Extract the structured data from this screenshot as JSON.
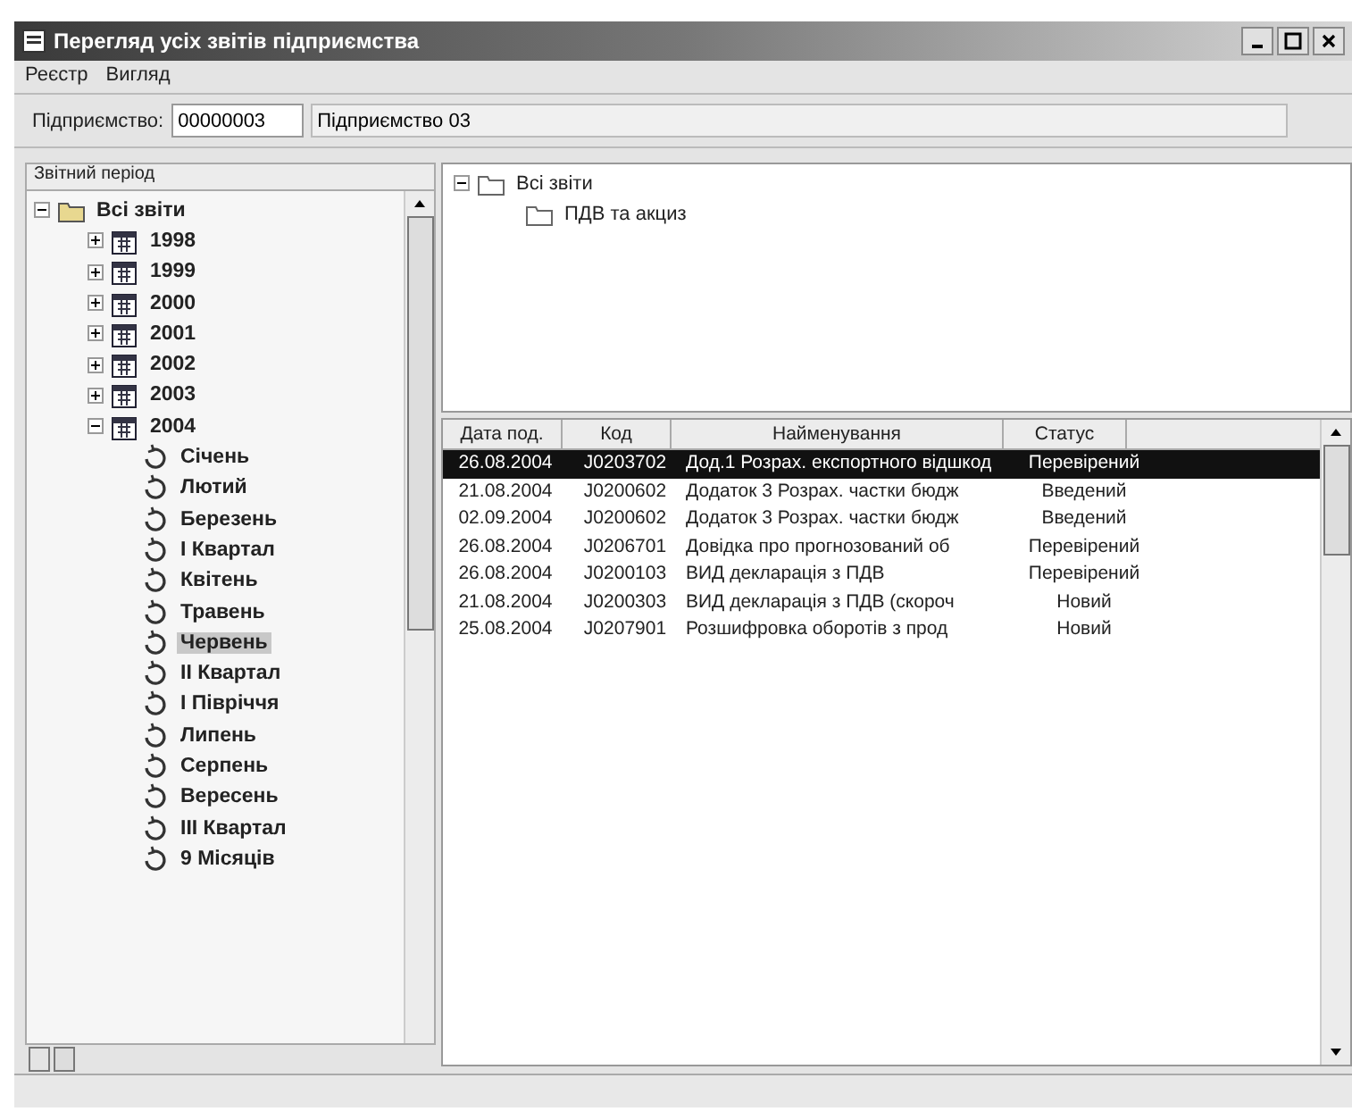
{
  "window": {
    "title": "Перегляд усіх звітів підприємства"
  },
  "menu": [
    "Реєстр",
    "Вигляд"
  ],
  "toolbar": {
    "label": "Підприємство:",
    "code": "00000003",
    "name": "Підприємство 03"
  },
  "period_tree": {
    "title": "Звітний період",
    "root": {
      "label": "Всі звіти",
      "expanded": true,
      "selected": false,
      "children": [
        {
          "label": "1998",
          "expanded": false,
          "selected": false
        },
        {
          "label": "1999",
          "expanded": false,
          "selected": false
        },
        {
          "label": "2000",
          "expanded": false,
          "selected": false
        },
        {
          "label": "2001",
          "expanded": false,
          "selected": false
        },
        {
          "label": "2002",
          "expanded": false,
          "selected": false
        },
        {
          "label": "2003",
          "expanded": false,
          "selected": false
        },
        {
          "label": "2004",
          "expanded": true,
          "selected": false,
          "children": [
            {
              "label": "Січень",
              "selected": false
            },
            {
              "label": "Лютий",
              "selected": false
            },
            {
              "label": "Березень",
              "selected": false
            },
            {
              "label": "I Квартал",
              "selected": false
            },
            {
              "label": "Квітень",
              "selected": false
            },
            {
              "label": "Травень",
              "selected": false
            },
            {
              "label": "Червень",
              "selected": true
            },
            {
              "label": "II Квартал",
              "selected": false
            },
            {
              "label": "I Півріччя",
              "selected": false
            },
            {
              "label": "Липень",
              "selected": false
            },
            {
              "label": "Серпень",
              "selected": false
            },
            {
              "label": "Вересень",
              "selected": false
            },
            {
              "label": "III Квартал",
              "selected": false
            },
            {
              "label": "9 Місяців",
              "selected": false
            }
          ]
        }
      ]
    }
  },
  "report_tree": {
    "root": {
      "label": "Всі звіти",
      "expanded": true,
      "children": [
        {
          "label": "ПДВ та акциз"
        }
      ]
    }
  },
  "table": {
    "columns": [
      "Дата под.",
      "Код",
      "Найменування",
      "Статус"
    ],
    "rows": [
      {
        "cells": [
          "26.08.2004",
          "J0203702",
          "Дод.1 Розрах. експортного відшкод",
          "Перевірений"
        ],
        "selected": true
      },
      {
        "cells": [
          "21.08.2004",
          "J0200602",
          "Додаток 3 Розрах. частки бюдж",
          "Введений"
        ],
        "selected": false
      },
      {
        "cells": [
          "02.09.2004",
          "J0200602",
          "Додаток 3 Розрах. частки бюдж",
          "Введений"
        ],
        "selected": false
      },
      {
        "cells": [
          "26.08.2004",
          "J0206701",
          "Довідка про прогнозований об",
          "Перевірений"
        ],
        "selected": false
      },
      {
        "cells": [
          "26.08.2004",
          "J0200103",
          "ВИД декларація з ПДВ",
          "Перевірений"
        ],
        "selected": false
      },
      {
        "cells": [
          "21.08.2004",
          "J0200303",
          "ВИД декларація з ПДВ (скороч",
          "Новий"
        ],
        "selected": false
      },
      {
        "cells": [
          "25.08.2004",
          "J0207901",
          "Розшифровка оборотів з прод",
          "Новий"
        ],
        "selected": false
      }
    ]
  }
}
